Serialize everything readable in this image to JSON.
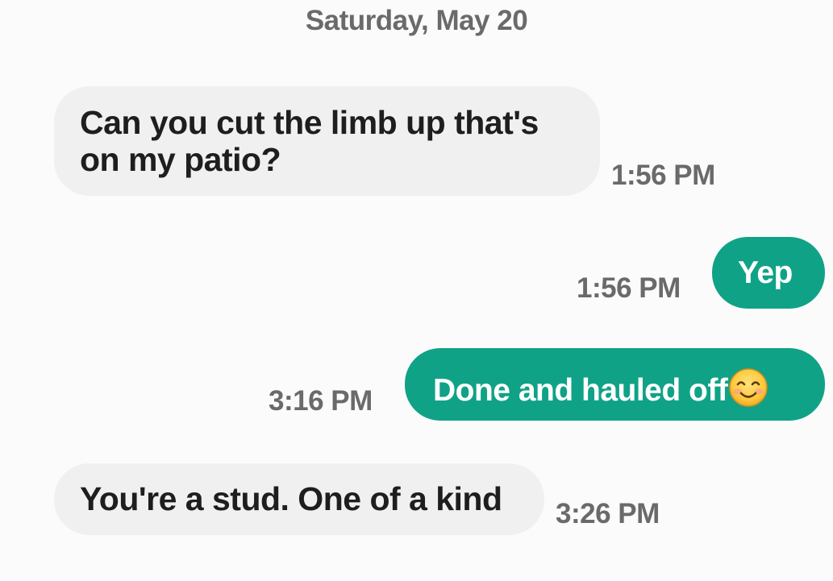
{
  "conversation": {
    "date_header": "Saturday, May 20",
    "messages": [
      {
        "direction": "incoming",
        "text": "Can you cut the limb up that's on my patio?",
        "time": "1:56 PM"
      },
      {
        "direction": "outgoing",
        "text": "Yep",
        "time": "1:56 PM"
      },
      {
        "direction": "outgoing",
        "text": "Done and hauled off",
        "emoji": "smiling-face-emoji",
        "time": "3:16 PM"
      },
      {
        "direction": "incoming",
        "text": "You're a stud. One of a kind",
        "time": "3:26 PM"
      }
    ]
  },
  "colors": {
    "background": "#fbfbfb",
    "incoming_bubble": "#f0f0f0",
    "outgoing_bubble": "#10a286",
    "timestamp": "#6a6a6a"
  }
}
